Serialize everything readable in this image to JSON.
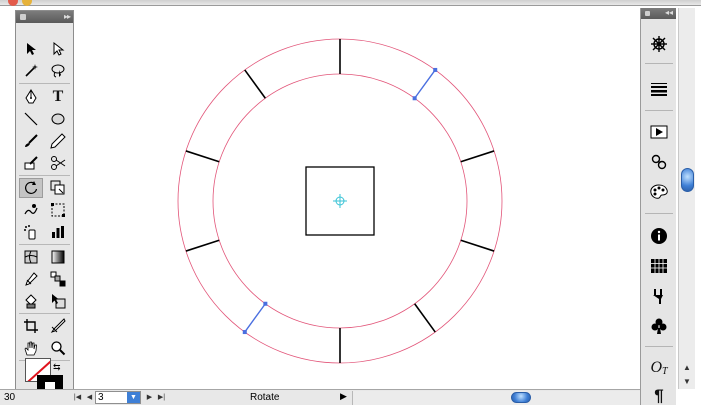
{
  "artboard_navigation": {
    "zoom": "30",
    "artboard_number": "3",
    "status_label": "Rotate"
  },
  "tools_panel": {
    "type_tool_glyph": "T",
    "tool_icons": [
      "selection-icon",
      "direct-selection-icon",
      "magic-wand-icon",
      "lasso-icon",
      "pen-icon",
      "type-icon",
      "line-segment-icon",
      "ellipse-icon",
      "paintbrush-icon",
      "pencil-icon",
      "blob-brush-icon",
      "scissors-icon",
      "rotate-icon",
      "scale-icon",
      "warp-icon",
      "free-transform-icon",
      "symbol-sprayer-icon",
      "column-graph-icon",
      "mesh-icon",
      "gradient-icon",
      "eyedropper-icon",
      "blend-icon",
      "live-paint-bucket-icon",
      "live-paint-selection-icon",
      "crop-icon",
      "slice-icon",
      "hand-icon",
      "zoom-icon"
    ],
    "selected_tool": "rotate-icon"
  },
  "dock_panel": {
    "opentype_label": "O",
    "paragraph_glyph": "¶",
    "icons": [
      "navigator-icon",
      "stroke-lines-icon",
      "actions-icon",
      "links-icon",
      "color-palette-icon",
      "info-icon",
      "swatches-grid-icon",
      "brushes-icon",
      "symbols-icon",
      "opentype-icon",
      "paragraph-icon"
    ]
  },
  "canvas": {
    "accent_guide_color": "#e25579",
    "selection_color": "#4a6fe0",
    "tick_count": 10
  },
  "colors": {
    "fill_none_slash": "#e0141e",
    "scroll_thumb": "#3e7fd6"
  }
}
